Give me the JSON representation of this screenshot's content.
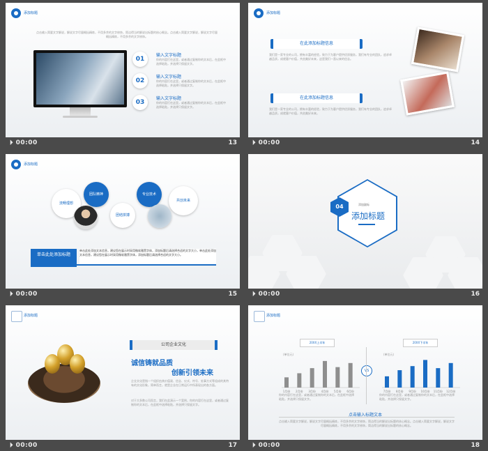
{
  "bottom_bar": {
    "time": "00:00",
    "icon": "slide-icon"
  },
  "header_label": "添加标题",
  "slides": [
    {
      "number": "13",
      "intro": "点击输入简要文字解说，解说文字尽量概括精炼，不用多余的文字修饰，简洁得当的解说出标题的核心概念。点击输入简要文字解说，解说文字尽量概括精炼，不用多余的文字修饰。",
      "items": [
        {
          "num": "01",
          "title": "输入文字标题",
          "desc": "你的内容打在这里，或者通过复制你的文本后，在此框中选择粘贴，并选择只保留文字。"
        },
        {
          "num": "02",
          "title": "输入文字标题",
          "desc": "你的内容打在这里，或者通过复制你的文本后，在此框中选择粘贴，并选择只保留文字。"
        },
        {
          "num": "03",
          "title": "输入文字标题",
          "desc": "你的内容打在这里，或者通过复制你的文本后，在此框中选择粘贴，并选择只保留文字。"
        }
      ]
    },
    {
      "number": "14",
      "blocks": [
        {
          "title": "在此添加标题信息",
          "text": "我们是一家专业的公司，拥有丰富的经验，致力于为客户提供优质服务，我们有专业的团队，追求卓越品质，成就客户价值，共创美好未来，这是我们一直以来的信念。"
        },
        {
          "title": "在此添加标题信息",
          "text": "我们是一家专业的公司，拥有丰富的经验，致力于为客户提供优质服务，我们有专业的团队，追求卓越品质，成就客户价值，共创美好未来。"
        }
      ]
    },
    {
      "number": "15",
      "circles": [
        "流畅理想",
        "团队精神",
        "团结拼搏",
        "专业技术",
        "共创未来"
      ],
      "button": "单击此处添加标题",
      "text": "单击此处添加文本信息，建议您在展示时采用微软雅黑字体，添加标题后请选择合适的文字大小，单击此处添加文本信息，建议您在展示时采用微软雅黑字体，添加标题后请选择合适的文字大小。"
    },
    {
      "number": "16",
      "badge": "04",
      "sub": "添加副标",
      "title": "添加标题"
    },
    {
      "number": "17",
      "tag": "公司企业文化",
      "line1": "诚信铸就品质",
      "line2": "创新引领未来",
      "text1": "企业文化是指一个组织由其价值观、信念、仪式、符号、处事方式等组成的其特有的文化形象，简单而言，就是企业在日常运行中所表现出的各方面。",
      "text2": "对于大多数公司而言，我们在此演示一个案例，你的内容打在这里，或者通过复制你的文本后，在此框中选择粘贴，并选择只保留文字。"
    },
    {
      "number": "18",
      "left_chart": {
        "label": "20XX上半年",
        "unit": "(单位元)",
        "categories": [
          "1月份",
          "2月份",
          "3月份",
          "4月份",
          "5月份",
          "6月份"
        ],
        "values": [
          20,
          28,
          38,
          52,
          40,
          48
        ]
      },
      "right_chart": {
        "label": "20XX下半年",
        "unit": "(单位元)",
        "categories": [
          "7月份",
          "8月份",
          "9月份",
          "10月份",
          "11月份",
          "12月份"
        ],
        "values": [
          22,
          34,
          42,
          54,
          38,
          48
        ]
      },
      "vs": "VS",
      "chart_note": "你的内容打在这里，或者通过复制你的文本后，在此框中选择粘贴，并选择只保留文字。",
      "caption": "点击输入标题文本",
      "text": "点击输入简要文字解说，解说文字尽量概括精炼，不用多余的文字修饰，简洁得当的解说出标题的核心概念。点击输入简要文字解说，解说文字尽量概括精炼，不用多余的文字修饰，简洁得当的解说出标题的核心概念。"
    }
  ],
  "colors": {
    "accent": "#1a6cc4",
    "bar_gray": "#8e8e8e",
    "bg": "#4a4a4a"
  }
}
